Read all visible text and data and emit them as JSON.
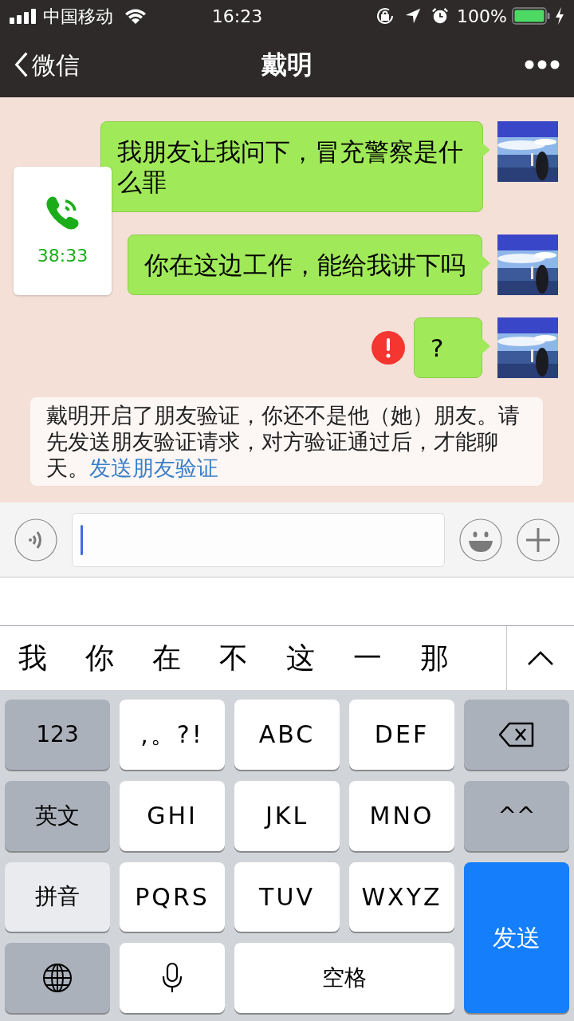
{
  "status_bar": {
    "carrier": "中国移动",
    "time": "16:23",
    "battery": "100%"
  },
  "nav": {
    "back": "微信",
    "title": "戴明"
  },
  "call_float": {
    "duration": "38:33"
  },
  "messages": [
    {
      "text": "我朋友让我问下，冒充警察是什么罪",
      "failed": false
    },
    {
      "text": "你在这边工作，能给我讲下吗",
      "failed": false
    },
    {
      "text": "?",
      "failed": true
    }
  ],
  "system_notice": {
    "text": "戴明开启了朋友验证，你还不是他（她）朋友。请先发送朋友验证请求，对方验证通过后，才能聊天。",
    "link": "发送朋友验证"
  },
  "candidates": [
    "我",
    "你",
    "在",
    "不",
    "这",
    "一",
    "那"
  ],
  "keys": [
    {
      "kind": "function",
      "label": "123",
      "selected": false
    },
    {
      "kind": "letter",
      "label": ",。?!"
    },
    {
      "kind": "letter",
      "label": "ABC"
    },
    {
      "kind": "letter",
      "label": "DEF"
    },
    {
      "kind": "delete"
    },
    {
      "kind": "function",
      "label": "英文",
      "selected": false
    },
    {
      "kind": "letter",
      "label": "GHI"
    },
    {
      "kind": "letter",
      "label": "JKL"
    },
    {
      "kind": "letter",
      "label": "MNO"
    },
    {
      "kind": "function",
      "label": "^^",
      "selected": false
    },
    {
      "kind": "function",
      "label": "拼音",
      "selected": true
    },
    {
      "kind": "letter",
      "label": "PQRS"
    },
    {
      "kind": "letter",
      "label": "TUV"
    },
    {
      "kind": "letter",
      "label": "WXYZ"
    },
    {
      "kind": "send",
      "label": "发送"
    },
    {
      "kind": "globe"
    },
    {
      "kind": "mic"
    },
    {
      "kind": "space",
      "label": "空格"
    }
  ]
}
